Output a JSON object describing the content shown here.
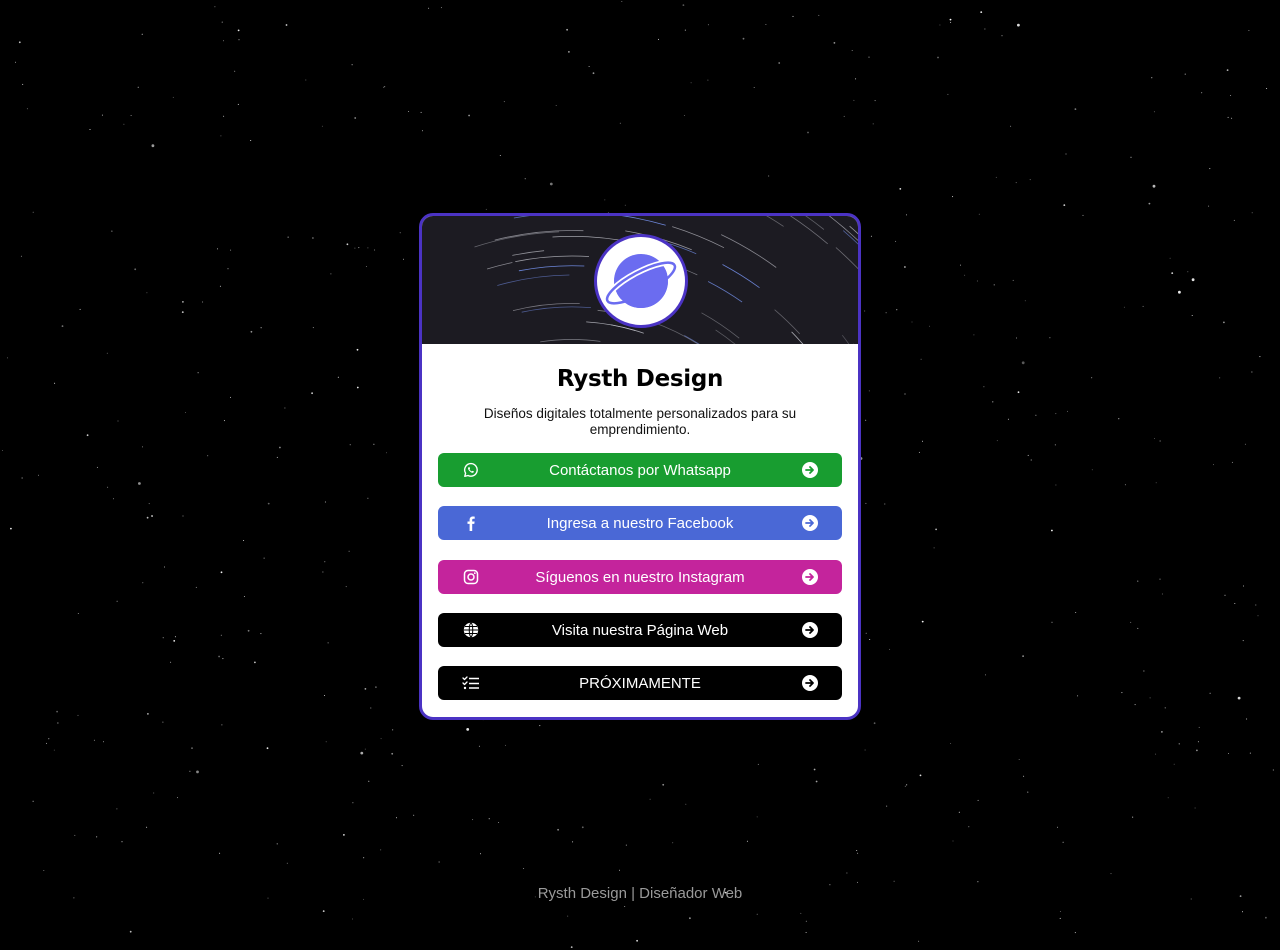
{
  "profile": {
    "name": "Rysth Design",
    "description": "Diseños digitales totalmente personalizados para su emprendimiento.",
    "avatar_icon": "planet-icon"
  },
  "links": [
    {
      "label": "Contáctanos por Whatsapp",
      "icon": "whatsapp-icon",
      "color": "#189d30"
    },
    {
      "label": "Ingresa a nuestro Facebook",
      "icon": "facebook-icon",
      "color": "#4a68d6"
    },
    {
      "label": "Síguenos en nuestro Instagram",
      "icon": "instagram-icon",
      "color": "#c4249c"
    },
    {
      "label": "Visita nuestra Página Web",
      "icon": "globe-icon",
      "color": "#000000"
    },
    {
      "label": "PRÓXIMAMENTE",
      "icon": "checklist-icon",
      "color": "#000000"
    }
  ],
  "footer": {
    "text": "Rysth Design | Diseñador Web"
  },
  "theme": {
    "accent": "#4b33c4",
    "planet": "#6b6cf0",
    "background": "#000000"
  }
}
